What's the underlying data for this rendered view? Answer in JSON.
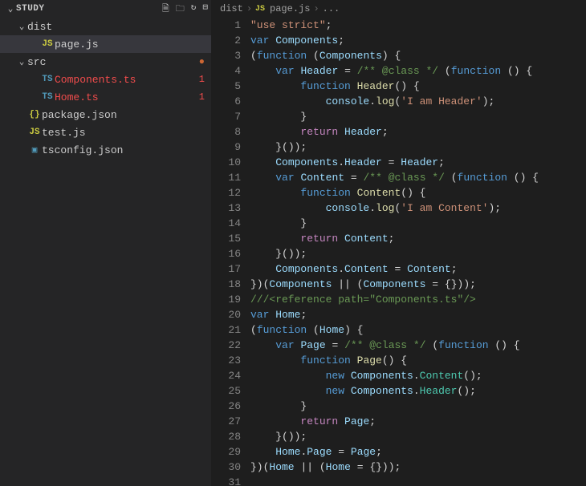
{
  "explorer": {
    "title": "STUDY",
    "tree": [
      {
        "kind": "folder",
        "label": "dist",
        "indent": 1,
        "open": true
      },
      {
        "kind": "file",
        "label": "page.js",
        "indent": 2,
        "icon": "js",
        "active": true
      },
      {
        "kind": "folder",
        "label": "src",
        "indent": 1,
        "open": true,
        "badge": "dot"
      },
      {
        "kind": "file",
        "label": "Components.ts",
        "indent": 2,
        "icon": "ts",
        "error": true,
        "badge": "1"
      },
      {
        "kind": "file",
        "label": "Home.ts",
        "indent": 2,
        "icon": "ts",
        "error": true,
        "badge": "1"
      },
      {
        "kind": "file",
        "label": "package.json",
        "indent": 1,
        "icon": "json"
      },
      {
        "kind": "file",
        "label": "test.js",
        "indent": 1,
        "icon": "js"
      },
      {
        "kind": "file",
        "label": "tsconfig.json",
        "indent": 1,
        "icon": "tsconfig"
      }
    ]
  },
  "breadcrumbs": {
    "segments": [
      "dist",
      "page.js"
    ],
    "trailing": "..."
  },
  "code": {
    "lines": [
      [
        [
          "tk-str",
          "\"use strict\""
        ],
        [
          "tk-punc",
          ";"
        ]
      ],
      [
        [
          "tk-kw",
          "var"
        ],
        [
          "tk-plain",
          " "
        ],
        [
          "tk-var",
          "Components"
        ],
        [
          "tk-punc",
          ";"
        ]
      ],
      [
        [
          "tk-punc",
          "("
        ],
        [
          "tk-kw",
          "function"
        ],
        [
          "tk-plain",
          " "
        ],
        [
          "tk-punc",
          "("
        ],
        [
          "tk-var",
          "Components"
        ],
        [
          "tk-punc",
          ") {"
        ]
      ],
      [
        [
          "tk-plain",
          "    "
        ],
        [
          "tk-kw",
          "var"
        ],
        [
          "tk-plain",
          " "
        ],
        [
          "tk-var",
          "Header"
        ],
        [
          "tk-plain",
          " "
        ],
        [
          "tk-punc",
          "="
        ],
        [
          "tk-plain",
          " "
        ],
        [
          "tk-comm",
          "/** @class */"
        ],
        [
          "tk-plain",
          " "
        ],
        [
          "tk-punc",
          "("
        ],
        [
          "tk-kw",
          "function"
        ],
        [
          "tk-plain",
          " "
        ],
        [
          "tk-punc",
          "() {"
        ]
      ],
      [
        [
          "tk-plain",
          "        "
        ],
        [
          "tk-kw",
          "function"
        ],
        [
          "tk-plain",
          " "
        ],
        [
          "tk-fn",
          "Header"
        ],
        [
          "tk-punc",
          "() {"
        ]
      ],
      [
        [
          "tk-plain",
          "            "
        ],
        [
          "tk-var",
          "console"
        ],
        [
          "tk-punc",
          "."
        ],
        [
          "tk-fn",
          "log"
        ],
        [
          "tk-punc",
          "("
        ],
        [
          "tk-str",
          "'I am Header'"
        ],
        [
          "tk-punc",
          ");"
        ]
      ],
      [
        [
          "tk-plain",
          "        "
        ],
        [
          "tk-punc",
          "}"
        ]
      ],
      [
        [
          "tk-plain",
          "        "
        ],
        [
          "tk-kw2",
          "return"
        ],
        [
          "tk-plain",
          " "
        ],
        [
          "tk-var",
          "Header"
        ],
        [
          "tk-punc",
          ";"
        ]
      ],
      [
        [
          "tk-plain",
          "    "
        ],
        [
          "tk-punc",
          "}());"
        ]
      ],
      [
        [
          "tk-plain",
          "    "
        ],
        [
          "tk-var",
          "Components"
        ],
        [
          "tk-punc",
          "."
        ],
        [
          "tk-prop",
          "Header"
        ],
        [
          "tk-plain",
          " "
        ],
        [
          "tk-punc",
          "="
        ],
        [
          "tk-plain",
          " "
        ],
        [
          "tk-var",
          "Header"
        ],
        [
          "tk-punc",
          ";"
        ]
      ],
      [
        [
          "tk-plain",
          "    "
        ],
        [
          "tk-kw",
          "var"
        ],
        [
          "tk-plain",
          " "
        ],
        [
          "tk-var",
          "Content"
        ],
        [
          "tk-plain",
          " "
        ],
        [
          "tk-punc",
          "="
        ],
        [
          "tk-plain",
          " "
        ],
        [
          "tk-comm",
          "/** @class */"
        ],
        [
          "tk-plain",
          " "
        ],
        [
          "tk-punc",
          "("
        ],
        [
          "tk-kw",
          "function"
        ],
        [
          "tk-plain",
          " "
        ],
        [
          "tk-punc",
          "() {"
        ]
      ],
      [
        [
          "tk-plain",
          "        "
        ],
        [
          "tk-kw",
          "function"
        ],
        [
          "tk-plain",
          " "
        ],
        [
          "tk-fn",
          "Content"
        ],
        [
          "tk-punc",
          "() {"
        ]
      ],
      [
        [
          "tk-plain",
          "            "
        ],
        [
          "tk-var",
          "console"
        ],
        [
          "tk-punc",
          "."
        ],
        [
          "tk-fn",
          "log"
        ],
        [
          "tk-punc",
          "("
        ],
        [
          "tk-str",
          "'I am Content'"
        ],
        [
          "tk-punc",
          ");"
        ]
      ],
      [
        [
          "tk-plain",
          "        "
        ],
        [
          "tk-punc",
          "}"
        ]
      ],
      [
        [
          "tk-plain",
          "        "
        ],
        [
          "tk-kw2",
          "return"
        ],
        [
          "tk-plain",
          " "
        ],
        [
          "tk-var",
          "Content"
        ],
        [
          "tk-punc",
          ";"
        ]
      ],
      [
        [
          "tk-plain",
          "    "
        ],
        [
          "tk-punc",
          "}());"
        ]
      ],
      [
        [
          "tk-plain",
          "    "
        ],
        [
          "tk-var",
          "Components"
        ],
        [
          "tk-punc",
          "."
        ],
        [
          "tk-prop",
          "Content"
        ],
        [
          "tk-plain",
          " "
        ],
        [
          "tk-punc",
          "="
        ],
        [
          "tk-plain",
          " "
        ],
        [
          "tk-var",
          "Content"
        ],
        [
          "tk-punc",
          ";"
        ]
      ],
      [
        [
          "tk-punc",
          "})("
        ],
        [
          "tk-var",
          "Components"
        ],
        [
          "tk-plain",
          " "
        ],
        [
          "tk-punc",
          "||"
        ],
        [
          "tk-plain",
          " "
        ],
        [
          "tk-punc",
          "("
        ],
        [
          "tk-var",
          "Components"
        ],
        [
          "tk-plain",
          " "
        ],
        [
          "tk-punc",
          "="
        ],
        [
          "tk-plain",
          " "
        ],
        [
          "tk-punc",
          "{}));"
        ]
      ],
      [
        [
          "tk-comm",
          "///<reference path=\"Components.ts\"/>"
        ]
      ],
      [
        [
          "tk-kw",
          "var"
        ],
        [
          "tk-plain",
          " "
        ],
        [
          "tk-var",
          "Home"
        ],
        [
          "tk-punc",
          ";"
        ]
      ],
      [
        [
          "tk-punc",
          "("
        ],
        [
          "tk-kw",
          "function"
        ],
        [
          "tk-plain",
          " "
        ],
        [
          "tk-punc",
          "("
        ],
        [
          "tk-var",
          "Home"
        ],
        [
          "tk-punc",
          ") {"
        ]
      ],
      [
        [
          "tk-plain",
          "    "
        ],
        [
          "tk-kw",
          "var"
        ],
        [
          "tk-plain",
          " "
        ],
        [
          "tk-var",
          "Page"
        ],
        [
          "tk-plain",
          " "
        ],
        [
          "tk-punc",
          "="
        ],
        [
          "tk-plain",
          " "
        ],
        [
          "tk-comm",
          "/** @class */"
        ],
        [
          "tk-plain",
          " "
        ],
        [
          "tk-punc",
          "("
        ],
        [
          "tk-kw",
          "function"
        ],
        [
          "tk-plain",
          " "
        ],
        [
          "tk-punc",
          "() {"
        ]
      ],
      [
        [
          "tk-plain",
          "        "
        ],
        [
          "tk-kw",
          "function"
        ],
        [
          "tk-plain",
          " "
        ],
        [
          "tk-fn",
          "Page"
        ],
        [
          "tk-punc",
          "() {"
        ]
      ],
      [
        [
          "tk-plain",
          "            "
        ],
        [
          "tk-kw",
          "new"
        ],
        [
          "tk-plain",
          " "
        ],
        [
          "tk-var",
          "Components"
        ],
        [
          "tk-punc",
          "."
        ],
        [
          "tk-type",
          "Content"
        ],
        [
          "tk-punc",
          "();"
        ]
      ],
      [
        [
          "tk-plain",
          "            "
        ],
        [
          "tk-kw",
          "new"
        ],
        [
          "tk-plain",
          " "
        ],
        [
          "tk-var",
          "Components"
        ],
        [
          "tk-punc",
          "."
        ],
        [
          "tk-type",
          "Header"
        ],
        [
          "tk-punc",
          "();"
        ]
      ],
      [
        [
          "tk-plain",
          "        "
        ],
        [
          "tk-punc",
          "}"
        ]
      ],
      [
        [
          "tk-plain",
          "        "
        ],
        [
          "tk-kw2",
          "return"
        ],
        [
          "tk-plain",
          " "
        ],
        [
          "tk-var",
          "Page"
        ],
        [
          "tk-punc",
          ";"
        ]
      ],
      [
        [
          "tk-plain",
          "    "
        ],
        [
          "tk-punc",
          "}());"
        ]
      ],
      [
        [
          "tk-plain",
          "    "
        ],
        [
          "tk-var",
          "Home"
        ],
        [
          "tk-punc",
          "."
        ],
        [
          "tk-prop",
          "Page"
        ],
        [
          "tk-plain",
          " "
        ],
        [
          "tk-punc",
          "="
        ],
        [
          "tk-plain",
          " "
        ],
        [
          "tk-var",
          "Page"
        ],
        [
          "tk-punc",
          ";"
        ]
      ],
      [
        [
          "tk-punc",
          "})("
        ],
        [
          "tk-var",
          "Home"
        ],
        [
          "tk-plain",
          " "
        ],
        [
          "tk-punc",
          "||"
        ],
        [
          "tk-plain",
          " "
        ],
        [
          "tk-punc",
          "("
        ],
        [
          "tk-var",
          "Home"
        ],
        [
          "tk-plain",
          " "
        ],
        [
          "tk-punc",
          "="
        ],
        [
          "tk-plain",
          " "
        ],
        [
          "tk-punc",
          "{}));"
        ]
      ],
      [
        [
          "tk-plain",
          ""
        ]
      ]
    ]
  }
}
